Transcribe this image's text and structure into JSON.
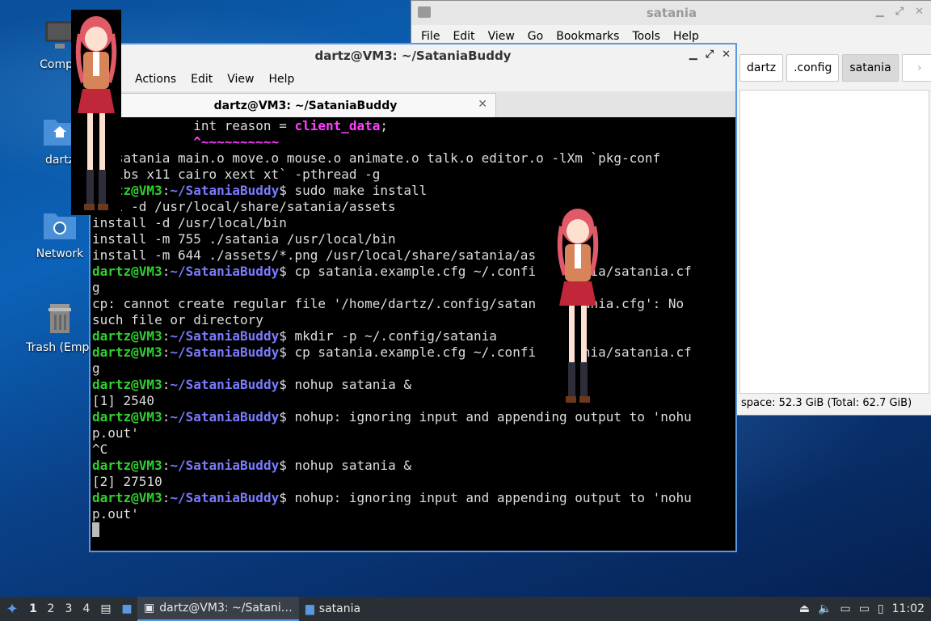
{
  "desktop": {
    "icons": [
      {
        "label": "Compu"
      },
      {
        "label": "dartz"
      },
      {
        "label": "Network"
      },
      {
        "label": "Trash (Empt"
      }
    ]
  },
  "file_manager": {
    "title": "satania",
    "menu": [
      "File",
      "Edit",
      "View",
      "Go",
      "Bookmarks",
      "Tools",
      "Help"
    ],
    "path": [
      "dartz",
      ".config",
      "satania"
    ],
    "status": "space: 52.3 GiB (Total: 62.7 GiB)"
  },
  "terminal": {
    "title": "dartz@VM3: ~/SataniaBuddy",
    "menu": [
      "Actions",
      "Edit",
      "View",
      "Help"
    ],
    "tab_label": "dartz@VM3: ~/SataniaBuddy",
    "prompt_user": "dartz@VM3",
    "prompt_path": "~/SataniaBuddy",
    "lines": {
      "l1a": "l0 |         int reason = ",
      "l1b": "client_data",
      "l1c": ";",
      "l2a": "   |         ",
      "l2b": "^~~~~~~~~~~",
      "l3": "-o satania main.o move.o mouse.o animate.o talk.o editor.o -lXm `pkg-conf",
      "l4": "--libs x11 cairo xext xt` -pthread -g",
      "c1": "sudo make install",
      "l5": "tall -d /usr/local/share/satania/assets",
      "l6": "install -d /usr/local/bin",
      "l7": "install -m 755 ./satania /usr/local/bin",
      "l8": "install -m 644 ./assets/*.png /usr/local/share/satania/as",
      "c2": "cp satania.example.cfg ~/.confi      nia/satania.cf",
      "l9": "g",
      "l10": "cp: cannot create regular file '/home/dartz/.config/satan      ania.cfg': No",
      "l11": "such file or directory",
      "c3": "mkdir -p ~/.config/satania",
      "c4": "cp satania.example.cfg ~/.confi      nia/satania.cf",
      "l12": "g",
      "c5": "nohup satania &",
      "l13": "[1] 2540",
      "c6": "nohup: ignoring input and appending output to 'nohu",
      "l14": "p.out'",
      "l15": "^C",
      "c7": "nohup satania &",
      "l16": "[2] 27510",
      "c8": "nohup: ignoring input and appending output to 'nohu",
      "l17": "p.out'"
    }
  },
  "panel": {
    "workspaces": [
      "1",
      "2",
      "3",
      "4"
    ],
    "tasks": [
      {
        "label": "dartz@VM3: ~/Satani…",
        "icon": "terminal-icon"
      },
      {
        "label": "satania",
        "icon": "folder-icon"
      }
    ],
    "clock": "11:02"
  }
}
